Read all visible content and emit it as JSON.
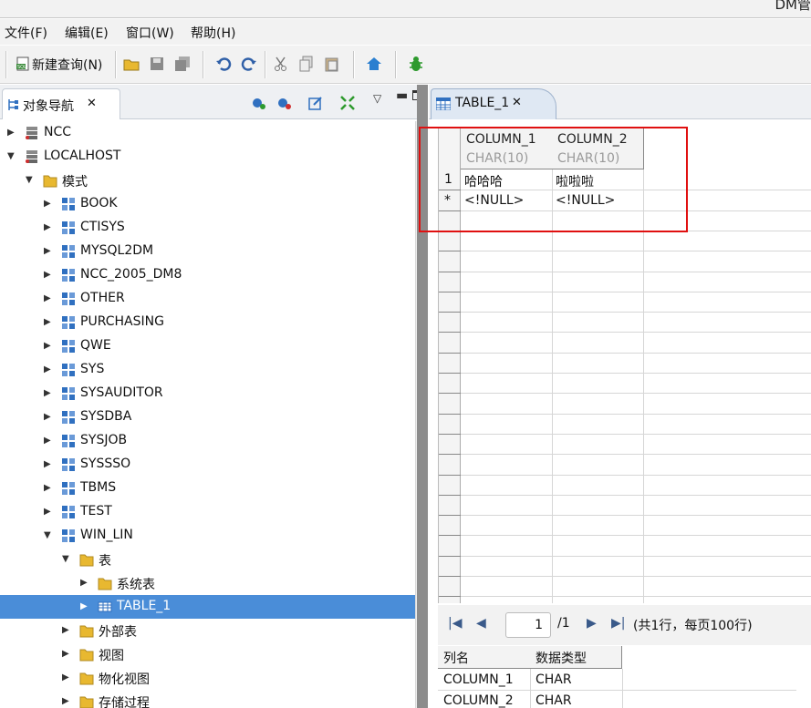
{
  "window": {
    "title_fragment": "DM管"
  },
  "menu": [
    "文件(F)",
    "编辑(E)",
    "窗口(W)",
    "帮助(H)"
  ],
  "toolbar": {
    "new_query_label": "新建查询(N)"
  },
  "left_panel": {
    "tab_label": "对象导航",
    "tree": [
      {
        "label": "NCC",
        "level": 0,
        "expanded": false,
        "icon": "server-icon"
      },
      {
        "label": "LOCALHOST",
        "level": 0,
        "expanded": true,
        "icon": "server-icon"
      },
      {
        "label": "模式",
        "level": 1,
        "expanded": true,
        "icon": "folder-icon"
      },
      {
        "label": "BOOK",
        "level": 2,
        "expanded": false,
        "icon": "schema-icon"
      },
      {
        "label": "CTISYS",
        "level": 2,
        "expanded": false,
        "icon": "schema-icon"
      },
      {
        "label": "MYSQL2DM",
        "level": 2,
        "expanded": false,
        "icon": "schema-icon"
      },
      {
        "label": "NCC_2005_DM8",
        "level": 2,
        "expanded": false,
        "icon": "schema-icon"
      },
      {
        "label": "OTHER",
        "level": 2,
        "expanded": false,
        "icon": "schema-icon"
      },
      {
        "label": "PURCHASING",
        "level": 2,
        "expanded": false,
        "icon": "schema-icon"
      },
      {
        "label": "QWE",
        "level": 2,
        "expanded": false,
        "icon": "schema-icon"
      },
      {
        "label": "SYS",
        "level": 2,
        "expanded": false,
        "icon": "schema-icon"
      },
      {
        "label": "SYSAUDITOR",
        "level": 2,
        "expanded": false,
        "icon": "schema-icon"
      },
      {
        "label": "SYSDBA",
        "level": 2,
        "expanded": false,
        "icon": "schema-icon"
      },
      {
        "label": "SYSJOB",
        "level": 2,
        "expanded": false,
        "icon": "schema-icon"
      },
      {
        "label": "SYSSSO",
        "level": 2,
        "expanded": false,
        "icon": "schema-icon"
      },
      {
        "label": "TBMS",
        "level": 2,
        "expanded": false,
        "icon": "schema-icon"
      },
      {
        "label": "TEST",
        "level": 2,
        "expanded": false,
        "icon": "schema-icon"
      },
      {
        "label": "WIN_LIN",
        "level": 2,
        "expanded": true,
        "icon": "schema-icon"
      },
      {
        "label": "表",
        "level": 3,
        "expanded": true,
        "icon": "folder-icon"
      },
      {
        "label": "系统表",
        "level": 4,
        "expanded": false,
        "icon": "folder-icon"
      },
      {
        "label": "TABLE_1",
        "level": 4,
        "expanded": false,
        "icon": "table-icon",
        "selected": true
      },
      {
        "label": "外部表",
        "level": 3,
        "expanded": false,
        "icon": "folder-icon"
      },
      {
        "label": "视图",
        "level": 3,
        "expanded": false,
        "icon": "folder-icon"
      },
      {
        "label": "物化视图",
        "level": 3,
        "expanded": false,
        "icon": "folder-icon"
      },
      {
        "label": "存储过程",
        "level": 3,
        "expanded": false,
        "icon": "folder-icon"
      }
    ]
  },
  "editor": {
    "tab_label": "TABLE_1",
    "columns": [
      {
        "name": "COLUMN_1",
        "type": "CHAR(10)"
      },
      {
        "name": "COLUMN_2",
        "type": "CHAR(10)"
      }
    ],
    "rows": [
      {
        "marker": "1",
        "values": [
          "哈哈哈",
          "啦啦啦"
        ]
      },
      {
        "marker": "*",
        "values": [
          "<!NULL>",
          "<!NULL>"
        ]
      }
    ],
    "pager": {
      "page": "1",
      "total": "/1",
      "summary": "(共1行，每页100行)"
    },
    "column_info": {
      "headers": [
        "列名",
        "数据类型"
      ],
      "rows": [
        [
          "COLUMN_1",
          "CHAR"
        ],
        [
          "COLUMN_2",
          "CHAR"
        ]
      ]
    }
  },
  "colors": {
    "selection": "#4a8dd8",
    "highlight_box": "#e01010",
    "folder": "#e8b830"
  }
}
